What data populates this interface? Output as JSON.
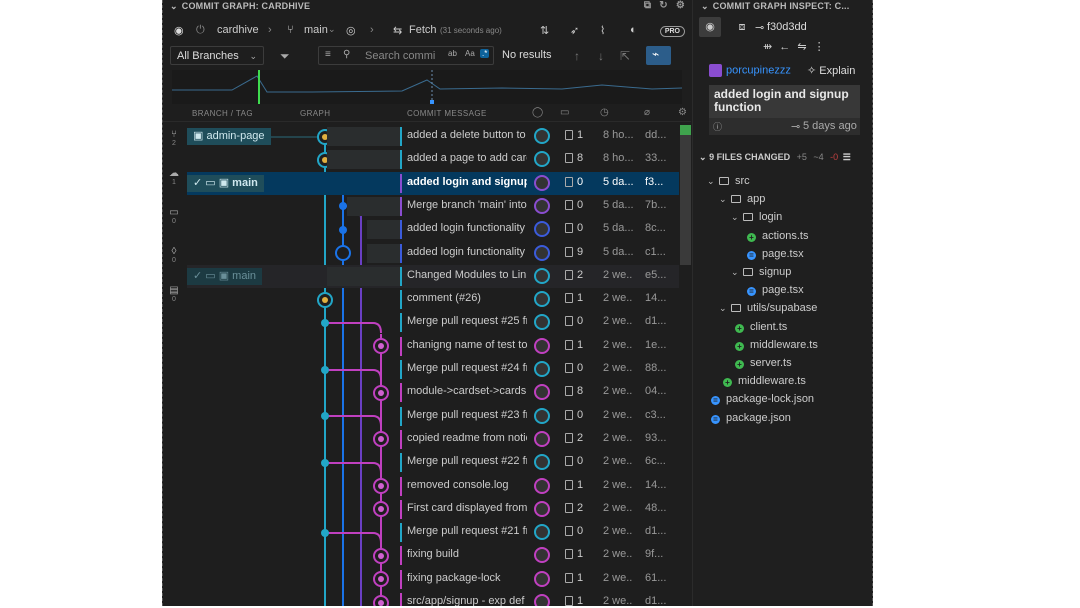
{
  "graph_panel": {
    "title": "COMMIT GRAPH: CARDHIVE",
    "toolbar": {
      "repo": "cardhive",
      "branch": "main",
      "fetch_label": "Fetch",
      "fetch_time": "(31 seconds ago)",
      "pro_badge": "PRO"
    },
    "filter": {
      "branch_select": "All Branches",
      "search_placeholder": "Search commi",
      "opt_ab": "ab",
      "opt_aa": "Aa",
      "opt_regex": ".*",
      "no_results": "No results"
    },
    "columns": {
      "branch": "BRANCH / TAG",
      "graph": "GRAPH",
      "message": "COMMIT MESSAGE"
    },
    "side_counts": [
      "2",
      "1",
      "0",
      "0",
      "0"
    ],
    "branch_labels": [
      {
        "text": "admin-page",
        "row": 0
      },
      {
        "text": "main",
        "row": 2
      },
      {
        "text": "main",
        "row": 6
      }
    ],
    "commits": [
      {
        "message": "added a delete button to t",
        "files": "1",
        "date": "8 ho...",
        "sha": "dd...",
        "color": "#22a6c7"
      },
      {
        "message": "added a page to add card",
        "files": "8",
        "date": "8 ho...",
        "sha": "33...",
        "color": "#22a6c7"
      },
      {
        "message": "added login and signup fu",
        "files": "0",
        "date": "5 da...",
        "sha": "f3...",
        "color": "#8a4dd0"
      },
      {
        "message": "Merge branch 'main' into",
        "files": "0",
        "date": "5 da...",
        "sha": "7b...",
        "color": "#8a4dd0"
      },
      {
        "message": "added login functionality",
        "files": "0",
        "date": "5 da...",
        "sha": "8c...",
        "color": "#3b5bdb"
      },
      {
        "message": "added login functionality",
        "files": "9",
        "date": "5 da...",
        "sha": "c1...",
        "color": "#3b5bdb"
      },
      {
        "message": "Changed Modules to Link",
        "files": "2",
        "date": "2 we...",
        "sha": "e5...",
        "color": "#22a6c7"
      },
      {
        "message": "comment (#26)",
        "files": "1",
        "date": "2 we...",
        "sha": "14...",
        "color": "#22a6c7"
      },
      {
        "message": "Merge pull request #25 fr",
        "files": "0",
        "date": "2 we...",
        "sha": "d1...",
        "color": "#22a6c7"
      },
      {
        "message": "chanigng name of test to",
        "files": "1",
        "date": "2 we...",
        "sha": "1e...",
        "color": "#c040c0"
      },
      {
        "message": "Merge pull request #24 fr",
        "files": "0",
        "date": "2 we...",
        "sha": "88...",
        "color": "#22a6c7"
      },
      {
        "message": "module->cardset->cards",
        "files": "8",
        "date": "2 we...",
        "sha": "04...",
        "color": "#c040c0"
      },
      {
        "message": "Merge pull request #23 fr",
        "files": "0",
        "date": "2 we...",
        "sha": "c3...",
        "color": "#22a6c7"
      },
      {
        "message": "copied readme from notio",
        "files": "2",
        "date": "2 we...",
        "sha": "93...",
        "color": "#c040c0"
      },
      {
        "message": "Merge pull request #22 fr",
        "files": "0",
        "date": "2 we...",
        "sha": "6c...",
        "color": "#22a6c7"
      },
      {
        "message": "removed console.log",
        "files": "1",
        "date": "2 we...",
        "sha": "14...",
        "color": "#c040c0"
      },
      {
        "message": "First card displayed from",
        "files": "2",
        "date": "2 we...",
        "sha": "48...",
        "color": "#c040c0"
      },
      {
        "message": "Merge pull request #21 fro",
        "files": "0",
        "date": "2 we...",
        "sha": "d1...",
        "color": "#22a6c7"
      },
      {
        "message": "fixing build",
        "files": "1",
        "date": "2 we...",
        "sha": "9f...",
        "color": "#c040c0"
      },
      {
        "message": "fixing package-lock",
        "files": "1",
        "date": "2 we...",
        "sha": "61...",
        "color": "#c040c0"
      },
      {
        "message": "src/app/signup - exp def f",
        "files": "1",
        "date": "2 we...",
        "sha": "d1...",
        "color": "#c040c0"
      }
    ]
  },
  "inspect_panel": {
    "title": "COMMIT GRAPH INSPECT: C...",
    "sha": "f30d3dd",
    "author": "porcupinezzz",
    "explain": "Explain",
    "commit_message": "added login and signup function",
    "time": "5 days ago",
    "files_changed_title": "9 FILES CHANGED",
    "stat_add": "+5",
    "stat_mod": "~4",
    "stat_del": "-0",
    "tree": [
      {
        "label": "src",
        "type": "folder",
        "depth": 0
      },
      {
        "label": "app",
        "type": "folder",
        "depth": 1
      },
      {
        "label": "login",
        "type": "folder",
        "depth": 2
      },
      {
        "label": "actions.ts",
        "type": "added",
        "depth": 3
      },
      {
        "label": "page.tsx",
        "type": "modified",
        "depth": 3
      },
      {
        "label": "signup",
        "type": "folder",
        "depth": 2
      },
      {
        "label": "page.tsx",
        "type": "modified",
        "depth": 3
      },
      {
        "label": "utils/supabase",
        "type": "folder",
        "depth": 1
      },
      {
        "label": "client.ts",
        "type": "added",
        "depth": 2
      },
      {
        "label": "middleware.ts",
        "type": "added",
        "depth": 2
      },
      {
        "label": "server.ts",
        "type": "added",
        "depth": 2
      },
      {
        "label": "middleware.ts",
        "type": "added",
        "depth": 1
      },
      {
        "label": "package-lock.json",
        "type": "modified",
        "depth": 0
      },
      {
        "label": "package.json",
        "type": "modified",
        "depth": 0
      }
    ]
  },
  "colors": {
    "accent": "#04395e",
    "lane_teal": "#22a6c7",
    "lane_blue": "#1a73e8",
    "lane_magenta": "#c040c0",
    "added": "#3fb950",
    "modified": "#3794ff"
  }
}
